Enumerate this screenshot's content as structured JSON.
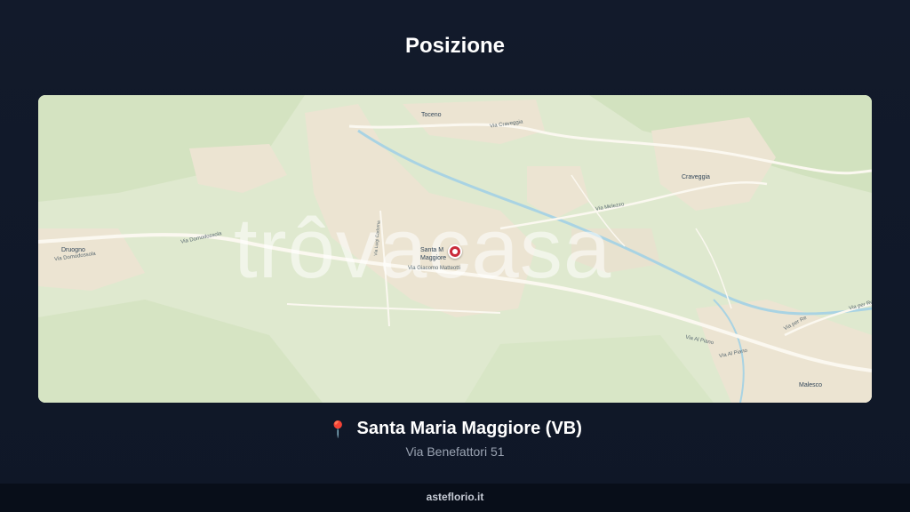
{
  "page": {
    "title": "Posizione"
  },
  "map": {
    "watermark": "trôvacasa",
    "places": {
      "toceno": "Toceno",
      "craveggia": "Craveggia",
      "druogno": "Druogno",
      "santa_maria_1": "Santa M",
      "santa_maria_2": "Maggiore",
      "malesco": "Malesco"
    },
    "streets": {
      "via_craveggia": "Via Craveggia",
      "via_domodossola_1": "Via Domodossola",
      "via_domodossola_2": "Via Domodossola",
      "via_giacomo_matteotti": "Via Giacomo Matteotti",
      "via_melezzo": "Via Melezzo",
      "via_al_piano_1": "Via Al Piano",
      "via_al_piano_2": "Via Al Piano",
      "via_per_re_1": "Via per Re",
      "via_per_re_2": "Via per Re",
      "vertical_street": "Via Luigi Cadorna"
    },
    "colors": {
      "land": "#dfe9cf",
      "built": "#efe6d6",
      "road": "#fbf8f0",
      "water": "#a9d3e3",
      "pin": "#c92a3a"
    }
  },
  "location": {
    "icon": "📍",
    "name": "Santa Maria Maggiore (VB)",
    "address": "Via Benefattori 51"
  },
  "footer": {
    "brand": "asteflorio.it"
  }
}
